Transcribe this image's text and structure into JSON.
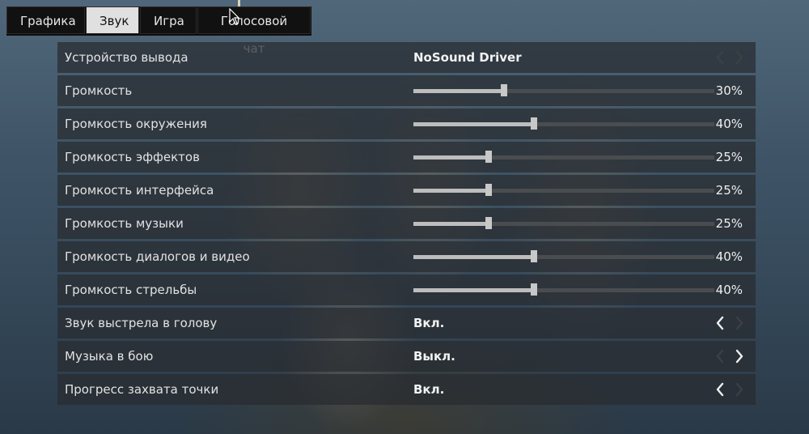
{
  "tabs": [
    {
      "label": "Графика",
      "active": false
    },
    {
      "label": "Звук",
      "active": true
    },
    {
      "label": "Игра",
      "active": false
    },
    {
      "label": "Голосовой чат",
      "active": false
    }
  ],
  "settings": [
    {
      "id": "output-device",
      "label": "Устройство вывода",
      "type": "select",
      "value": "NoSound Driver",
      "left_enabled": false,
      "right_enabled": false
    },
    {
      "id": "volume",
      "label": "Громкость",
      "type": "slider",
      "percent": 30,
      "display": "30%"
    },
    {
      "id": "ambient-volume",
      "label": "Громкость окружения",
      "type": "slider",
      "percent": 40,
      "display": "40%"
    },
    {
      "id": "effects-volume",
      "label": "Громкость эффектов",
      "type": "slider",
      "percent": 25,
      "display": "25%"
    },
    {
      "id": "ui-volume",
      "label": "Громкость интерфейса",
      "type": "slider",
      "percent": 25,
      "display": "25%"
    },
    {
      "id": "music-volume",
      "label": "Громкость музыки",
      "type": "slider",
      "percent": 25,
      "display": "25%"
    },
    {
      "id": "dialog-volume",
      "label": "Громкость диалогов и видео",
      "type": "slider",
      "percent": 40,
      "display": "40%"
    },
    {
      "id": "gunfire-volume",
      "label": "Громкость стрельбы",
      "type": "slider",
      "percent": 40,
      "display": "40%"
    },
    {
      "id": "headshot-sound",
      "label": "Звук выстрела в голову",
      "type": "select",
      "value": "Вкл.",
      "left_enabled": true,
      "right_enabled": false
    },
    {
      "id": "combat-music",
      "label": "Музыка в бою",
      "type": "select",
      "value": "Выкл.",
      "left_enabled": false,
      "right_enabled": true
    },
    {
      "id": "capture-progress",
      "label": "Прогресс захвата точки",
      "type": "select",
      "value": "Вкл.",
      "left_enabled": true,
      "right_enabled": false
    }
  ],
  "colors": {
    "active_tab": "#e0e0e0",
    "arrow_enabled": "#f0f0f0",
    "arrow_disabled": "#3c4044"
  }
}
